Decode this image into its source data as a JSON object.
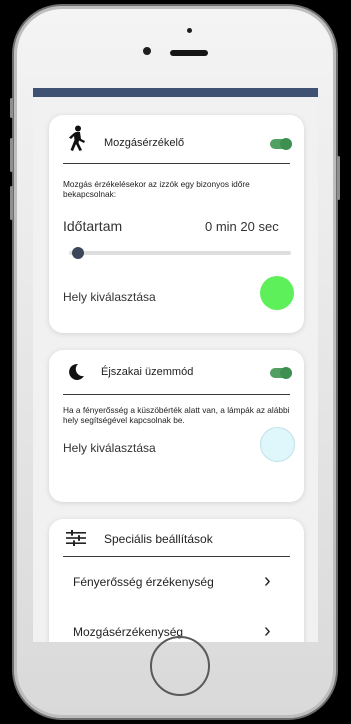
{
  "motion": {
    "title": "Mozgásérzékelő",
    "toggle_on": true,
    "description": "Mozgás érzékelésekor az izzók egy bizonyos időre bekapcsolnak:",
    "duration_label": "Időtartam",
    "duration_value": "0 min 20 sec",
    "slider_fraction": 0.03,
    "location_label": "Hely kiválasztása",
    "location_color": "#5ef05b"
  },
  "night": {
    "title": "Éjszakai üzemmód",
    "toggle_on": true,
    "description": "Ha a fényerősség a küszöbérték alatt van, a lámpák az alábbi hely segítségével kapcsolnak be.",
    "location_label": "Hely kiválasztása",
    "location_color": "#dff6fb"
  },
  "special": {
    "title": "Speciális beállítások",
    "items": [
      {
        "label": "Fényerősség érzékenység"
      },
      {
        "label": "Mozgásérzékenység"
      }
    ]
  },
  "colors": {
    "topbar": "#405273",
    "toggle": "#4fa061"
  },
  "icons": {
    "motion": "walking-person-icon",
    "night": "crescent-moon-icon",
    "special": "sliders-icon",
    "chevron": "chevron-right-icon"
  }
}
